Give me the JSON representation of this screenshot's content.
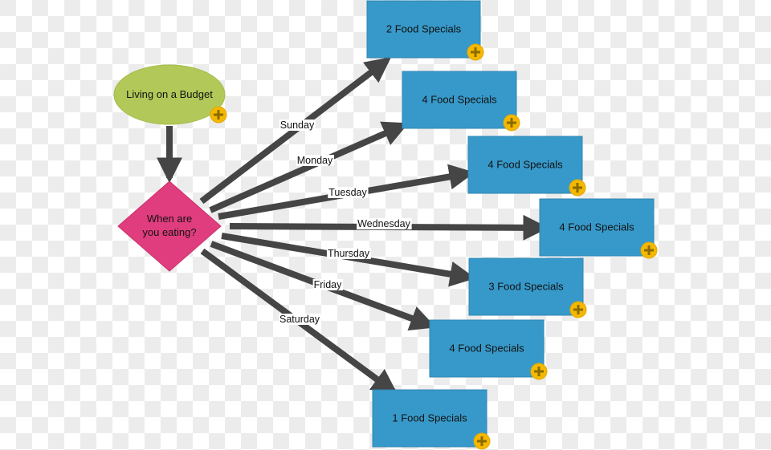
{
  "diagram": {
    "start_node": {
      "label": "Living on a Budget"
    },
    "decision_node": {
      "label_lines": [
        "When are",
        "you eating?"
      ]
    },
    "branches": [
      {
        "day": "Sunday",
        "target_label": "2 Food Specials"
      },
      {
        "day": "Monday",
        "target_label": "4 Food Specials"
      },
      {
        "day": "Tuesday",
        "target_label": "4 Food Specials"
      },
      {
        "day": "Wednesday",
        "target_label": "4 Food Specials"
      },
      {
        "day": "Thursday",
        "target_label": "3 Food Specials"
      },
      {
        "day": "Friday",
        "target_label": "4 Food Specials"
      },
      {
        "day": "Saturday",
        "target_label": "1 Food Specials"
      }
    ],
    "colors": {
      "start_fill": "#b2c959",
      "decision_fill": "#e03d7e",
      "box_fill": "#3799c9",
      "arrow": "#454545",
      "add_badge": "#f5b800",
      "add_badge_plus": "#8a6b00"
    },
    "icons": {
      "add_badge": "plus-circle-icon"
    }
  }
}
